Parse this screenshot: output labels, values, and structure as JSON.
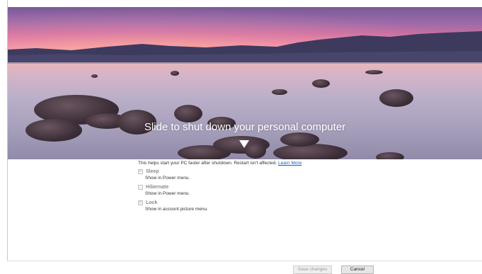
{
  "overlay": {
    "title": "Slide to shut down your personal computer",
    "arrow_icon": "arrow-down-icon"
  },
  "settings": {
    "hint_text": "This helps start your PC faster after shutdown. Restart isn't affected.",
    "learn_more": "Learn More",
    "options": [
      {
        "label": "Sleep",
        "description": "Show in Power menu.",
        "checked": true
      },
      {
        "label": "Hibernate",
        "description": "Show in Power menu.",
        "checked": false
      },
      {
        "label": "Lock",
        "description": "Show in account picture menu.",
        "checked": true
      }
    ]
  },
  "footer": {
    "save_label": "Save changes",
    "cancel_label": "Cancel"
  }
}
